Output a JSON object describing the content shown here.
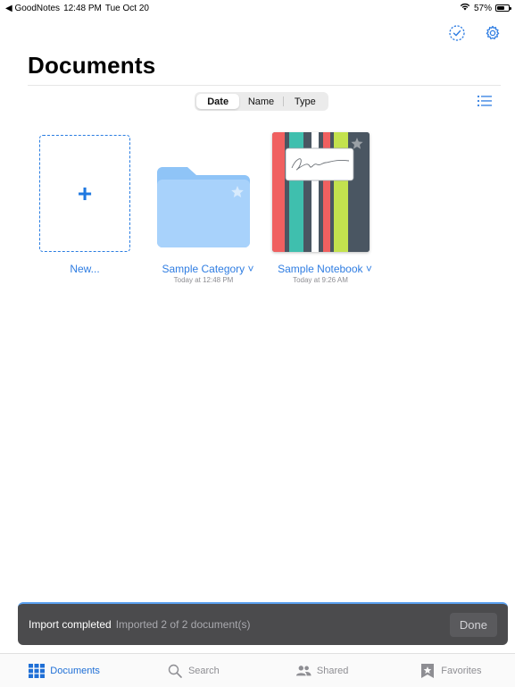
{
  "status_bar": {
    "back_app": "◀ GoodNotes",
    "time": "12:48 PM",
    "date": "Tue Oct 20",
    "battery": "57%"
  },
  "header": {
    "title": "Documents"
  },
  "sort_control": {
    "options": [
      "Date",
      "Name",
      "Type"
    ],
    "selected": "Date"
  },
  "items": [
    {
      "label": "New...",
      "sublabel": ""
    },
    {
      "label": "Sample Category ˅",
      "sublabel": "Today at 12:48 PM"
    },
    {
      "label": "Sample Notebook ˅",
      "sublabel": "Today at 9:26 AM"
    }
  ],
  "toast": {
    "title": "Import completed",
    "message": "Imported 2 of 2 document(s)",
    "done_label": "Done"
  },
  "tabs": [
    {
      "label": "Documents",
      "icon": "grid-icon",
      "active": true
    },
    {
      "label": "Search",
      "icon": "search-icon",
      "active": false
    },
    {
      "label": "Shared",
      "icon": "people-icon",
      "active": false
    },
    {
      "label": "Favorites",
      "icon": "star-bookmark-icon",
      "active": false
    }
  ],
  "colors": {
    "accent": "#2f7de2",
    "folder": "#a8d2fb",
    "toast_bg": "#4b4b4d"
  }
}
